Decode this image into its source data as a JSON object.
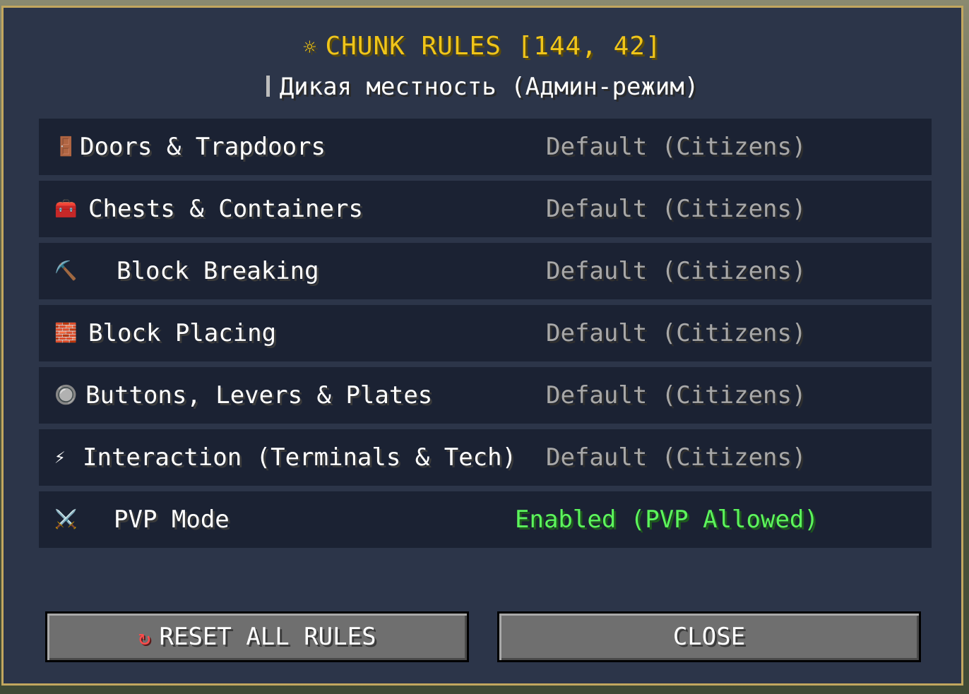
{
  "dialog": {
    "title_icon": "☼",
    "title": "CHUNK RULES [144, 42]",
    "subtitle": "Дикая местность (Админ-режим)"
  },
  "rules": [
    {
      "icon": "🚪",
      "icon_name": "door-icon",
      "label": "Doors & Trapdoors",
      "value": "Default (Citizens)"
    },
    {
      "icon": "🧰",
      "icon_name": "chest-icon",
      "label": "Chests & Containers",
      "value": "Default (Citizens)"
    },
    {
      "icon": "⛏️",
      "icon_name": "pickaxe-icon",
      "label": "Block Breaking",
      "value": "Default (Citizens)"
    },
    {
      "icon": "🧱",
      "icon_name": "brick-icon",
      "label": "Block Placing",
      "value": "Default (Citizens)"
    },
    {
      "icon": "🔘",
      "icon_name": "radio-button-icon",
      "label": "Buttons, Levers & Plates",
      "value": "Default (Citizens)"
    },
    {
      "icon": "⚡",
      "icon_name": "lightning-icon",
      "label": "Interaction (Terminals & Tech)",
      "value": "Default (Citizens)"
    },
    {
      "icon": "⚔️",
      "icon_name": "crossed-swords-icon",
      "label": "PVP Mode",
      "value": "Enabled (PVP Allowed)"
    }
  ],
  "buttons": {
    "reset_icon": "↻",
    "reset_label": "RESET ALL RULES",
    "close_label": "CLOSE"
  },
  "colors": {
    "title": "#f0c51a",
    "default_value": "#a8a8a8",
    "enabled_value": "#5cf55c",
    "panel_border": "#c2a75f"
  }
}
